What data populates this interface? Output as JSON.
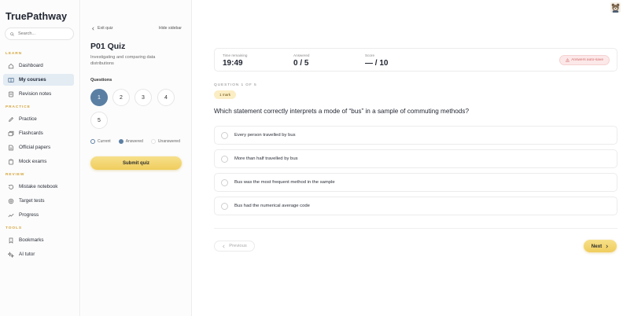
{
  "app": {
    "brand": "TruePathway"
  },
  "search": {
    "placeholder": "Search..."
  },
  "sidebar": {
    "sections": [
      {
        "label": "LEARN",
        "items": [
          {
            "label": "Dashboard",
            "icon": "home-icon"
          },
          {
            "label": "My courses",
            "icon": "book-icon",
            "active": true
          },
          {
            "label": "Revision notes",
            "icon": "notes-icon"
          }
        ]
      },
      {
        "label": "PRACTICE",
        "items": [
          {
            "label": "Practice",
            "icon": "pencil-icon"
          },
          {
            "label": "Flashcards",
            "icon": "cards-icon"
          },
          {
            "label": "Official papers",
            "icon": "papers-icon"
          },
          {
            "label": "Mock exams",
            "icon": "clipboard-icon"
          }
        ]
      },
      {
        "label": "REVIEW",
        "items": [
          {
            "label": "Mistake notebook",
            "icon": "history-icon"
          },
          {
            "label": "Target tests",
            "icon": "target-icon"
          },
          {
            "label": "Progress",
            "icon": "trend-icon"
          }
        ]
      },
      {
        "label": "TOOLS",
        "items": [
          {
            "label": "Bookmarks",
            "icon": "bookmark-icon"
          },
          {
            "label": "AI tutor",
            "icon": "ai-icon"
          }
        ]
      }
    ]
  },
  "quiz": {
    "exit_label": "Exit quiz",
    "hide_sidebar_label": "Hide sidebar",
    "title": "P01 Quiz",
    "subtitle": "Investigating and comparing data distributions",
    "questions_label": "Questions",
    "question_numbers": [
      "1",
      "2",
      "3",
      "4",
      "5"
    ],
    "current_question": 1,
    "legend": {
      "current": "Current",
      "answered": "Answered",
      "unanswered": "Unanswered"
    },
    "submit_label": "Submit quiz"
  },
  "stats": {
    "time_label": "Time remaining",
    "time_value": "19:49",
    "answered_label": "Answered",
    "answered_value": "0 / 5",
    "score_label": "Score",
    "score_value": "— / 10",
    "autosave_label": "Answers auto-save"
  },
  "question": {
    "counter": "QUESTION 1 OF 5",
    "marks": "1 mark",
    "text": "Which statement correctly interprets a mode of “bus” in a sample of commuting methods?",
    "options": [
      "Every person travelled by bus",
      "More than half travelled by bus",
      "Bus was the most frequent method in the sample",
      "Bus had the numerical average code"
    ]
  },
  "nav": {
    "previous_label": "Previous",
    "next_label": "Next"
  },
  "colors": {
    "accent_blue": "#5b7fa3",
    "accent_gold": "#f0cd5d",
    "section_label": "#d4a43a",
    "active_nav_bg": "#e3ebf3",
    "autosave_text": "#d46a6a"
  }
}
